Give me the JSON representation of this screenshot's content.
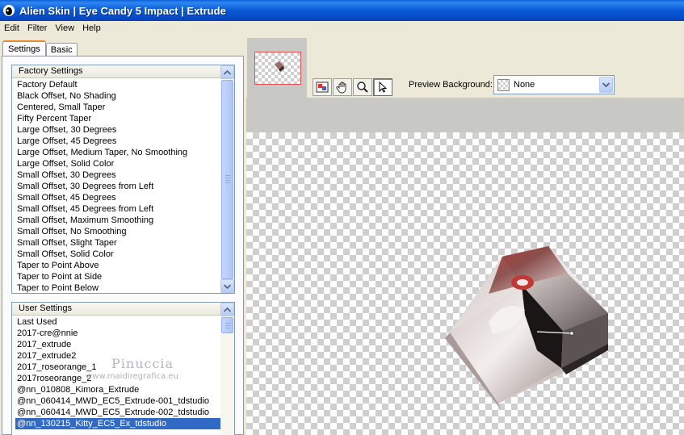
{
  "window": {
    "title": "Alien Skin | Eye Candy 5 Impact | Extrude"
  },
  "menu": [
    "Edit",
    "Filter",
    "View",
    "Help"
  ],
  "tabs": {
    "settings": "Settings",
    "basic": "Basic"
  },
  "factory_settings": {
    "header": "Factory Settings",
    "items": [
      "Factory Default",
      "Black Offset, No Shading",
      "Centered, Small Taper",
      "Fifty Percent Taper",
      "Large Offset, 30 Degrees",
      "Large Offset, 45 Degrees",
      "Large Offset, Medium Taper, No Smoothing",
      "Large Offset, Solid Color",
      "Small Offset, 30 Degrees",
      "Small Offset, 30 Degrees from Left",
      "Small Offset, 45 Degrees",
      "Small Offset, 45 Degrees from Left",
      "Small Offset, Maximum Smoothing",
      "Small Offset, No Smoothing",
      "Small Offset, Slight Taper",
      "Small Offset, Solid Color",
      "Taper to Point Above",
      "Taper to Point at Side",
      "Taper to Point Below"
    ]
  },
  "user_settings": {
    "header": "User Settings",
    "items": [
      "Last Used",
      "2017-cre@nnie",
      "2017_extrude",
      "2017_extrude2",
      "2017_roseorange_1",
      "2017roseorange_2",
      "@nn_010808_Kimora_Extrude",
      "@nn_060414_MWD_EC5_Extrude-001_tdstudio",
      "@nn_060414_MWD_EC5_Extrude-002_tdstudio",
      "@nn_130215_Kitty_EC5_Ex_tdstudio"
    ],
    "selected_index": 9
  },
  "preview_background": {
    "label": "Preview Background:",
    "value": "None"
  },
  "watermark": {
    "name": "Pinuccia",
    "url": "www.maidiregrafica.eu"
  },
  "colors": {
    "titlebar": "#0a58d6",
    "selection": "#316ac5",
    "panel": "#ece9d8"
  },
  "icons": [
    "app-logo-icon",
    "preview-icon",
    "hand-icon",
    "zoom-icon",
    "arrow-icon",
    "chevron-down-icon",
    "scroll-up-icon",
    "scroll-down-icon"
  ]
}
